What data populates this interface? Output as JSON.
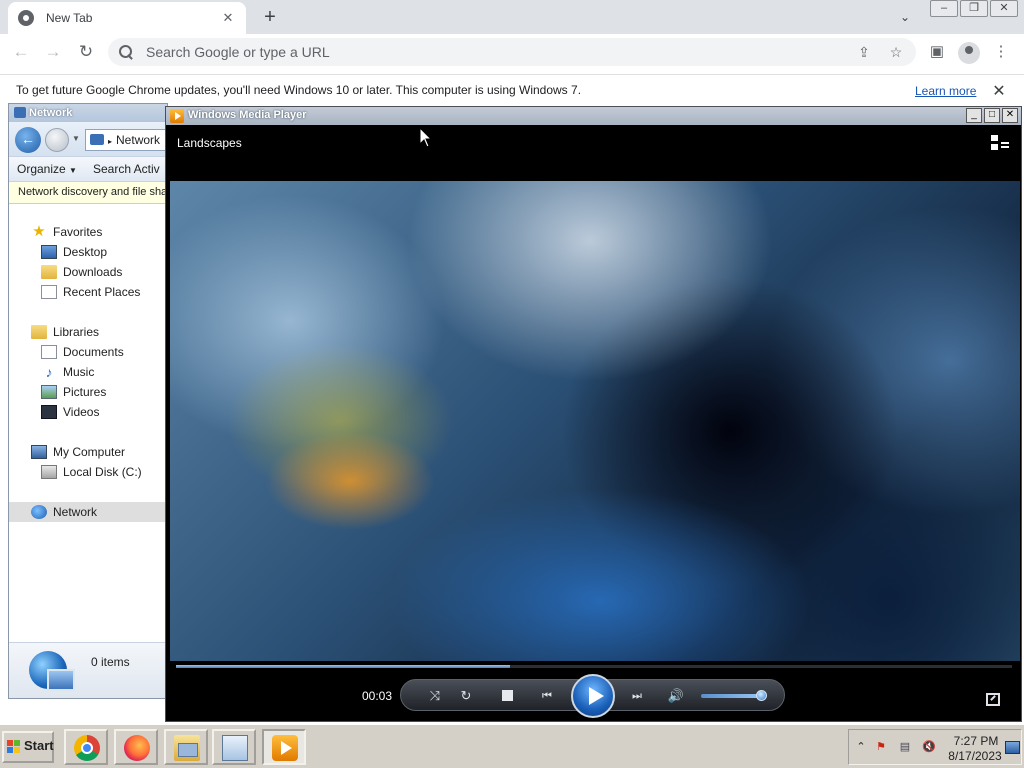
{
  "chrome": {
    "tab_title": "New Tab",
    "tab_close": "✕",
    "new_tab": "+",
    "omnibox_placeholder": "Search Google or type a URL",
    "infobar_text": "To get future Google Chrome updates, you'll need Windows 10 or later. This computer is using Windows 7.",
    "learn_more": "Learn more",
    "infobar_close": "✕"
  },
  "explorer": {
    "title": "Network",
    "address": "Network",
    "commands": [
      "Organize",
      "Search Activ"
    ],
    "info_bar": "Network discovery and file sha",
    "nav": {
      "favorites": "Favorites",
      "desktop": "Desktop",
      "downloads": "Downloads",
      "recent_places": "Recent Places",
      "libraries": "Libraries",
      "documents": "Documents",
      "music": "Music",
      "pictures": "Pictures",
      "videos": "Videos",
      "my_computer": "My Computer",
      "local_disk": "Local Disk (C:)",
      "network": "Network"
    },
    "items_count": "0 items"
  },
  "wmp": {
    "title": "Windows Media Player",
    "now_playing": "Landscapes",
    "elapsed": "00:03",
    "seek_progress": 0.4,
    "volume": 0.95
  },
  "taskbar": {
    "start": "Start",
    "clock_time": "7:27 PM",
    "clock_date": "8/17/2023"
  },
  "colors": {
    "chrome_tabstrip": "#dee1e6",
    "link": "#1a56b3",
    "wmp_accent": "#1a5fb8",
    "taskbar": "#d4d0c8"
  },
  "icons": [
    "chrome-favicon-icon",
    "search-icon",
    "share-icon",
    "bookmark-star-icon",
    "side-panel-icon",
    "profile-icon",
    "menu-icon",
    "network-icon",
    "globe-icon",
    "wmp-logo-icon",
    "play-icon",
    "stop-icon",
    "shuffle-icon",
    "repeat-icon",
    "previous-icon",
    "next-icon",
    "volume-icon",
    "fullscreen-icon",
    "windows-logo-icon"
  ]
}
